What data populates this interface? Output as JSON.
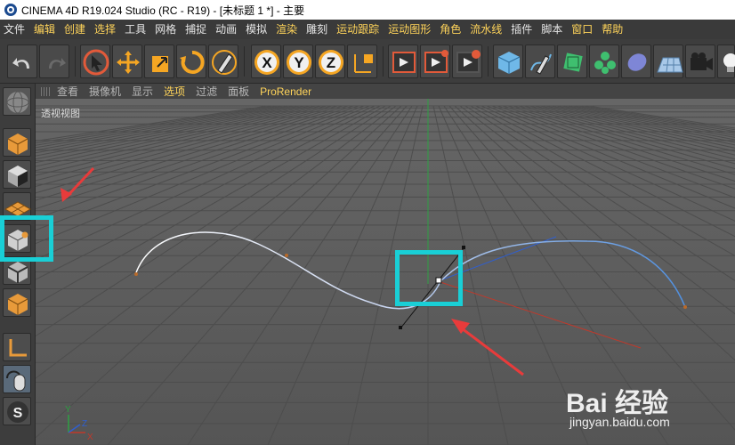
{
  "window": {
    "title": "CINEMA 4D R19.024 Studio (RC - R19) - [未标题 1 *] - 主要"
  },
  "menu": [
    {
      "label": "文件"
    },
    {
      "label": "编辑"
    },
    {
      "label": "创建"
    },
    {
      "label": "选择"
    },
    {
      "label": "工具"
    },
    {
      "label": "网格"
    },
    {
      "label": "捕捉"
    },
    {
      "label": "动画"
    },
    {
      "label": "模拟"
    },
    {
      "label": "渲染"
    },
    {
      "label": "雕刻"
    },
    {
      "label": "运动跟踪"
    },
    {
      "label": "运动图形"
    },
    {
      "label": "角色"
    },
    {
      "label": "流水线"
    },
    {
      "label": "插件"
    },
    {
      "label": "脚本"
    },
    {
      "label": "窗口"
    },
    {
      "label": "帮助"
    }
  ],
  "viewport_menu": [
    {
      "label": "查看"
    },
    {
      "label": "摄像机"
    },
    {
      "label": "显示"
    },
    {
      "label": "选项"
    },
    {
      "label": "过滤"
    },
    {
      "label": "面板"
    },
    {
      "label": "ProRender"
    }
  ],
  "viewport": {
    "label": "透视视图"
  },
  "axis_gizmo": {
    "x": "X",
    "y": "Y",
    "z": "Z"
  },
  "toolbar": {
    "undo": "undo-icon",
    "redo": "redo-icon",
    "x_lock": "X",
    "y_lock": "Y",
    "z_lock": "Z"
  },
  "watermark": {
    "logo": "Bai 经验",
    "url": "jingyan.baidu.com"
  },
  "colors": {
    "accent": "#ffd45a",
    "highlight": "#19cfd6",
    "annotation_arrow": "#e83b3b",
    "spline_start": "#ffffff",
    "spline_end": "#4f8fe0",
    "axis_x": "#c0392b",
    "axis_y": "#2ea043",
    "axis_z": "#2f5fd0"
  }
}
